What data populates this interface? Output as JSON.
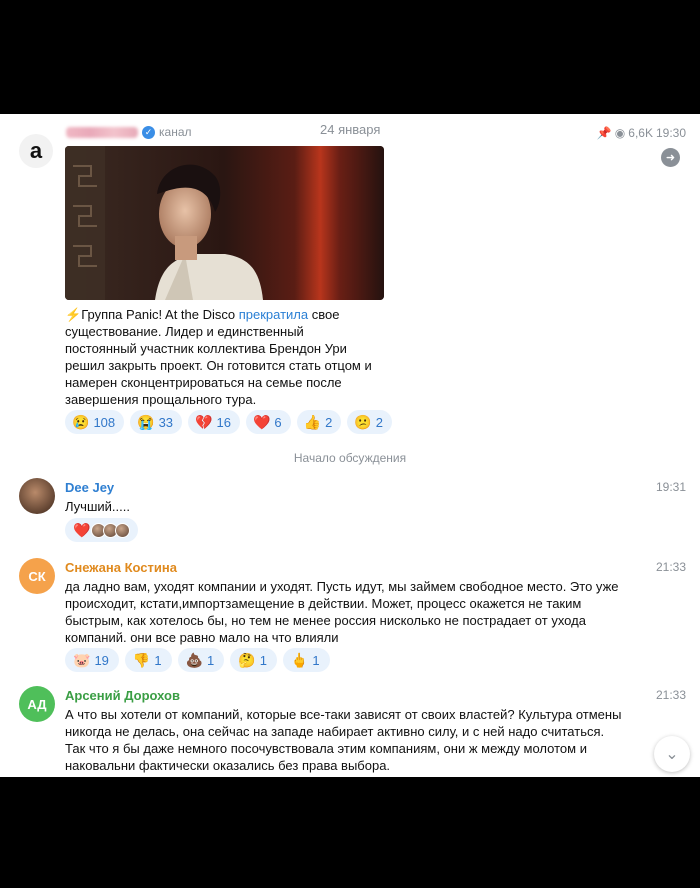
{
  "post": {
    "avatar_letter": "a",
    "channel_label": "канал",
    "date": "24 января",
    "views": "6,6K",
    "time": "19:30",
    "text_before": "Группа Panic! At the Disco ",
    "text_link": "прекратила",
    "text_after": " свое существование. Лидер и единственный постоянный участник коллектива Брендон Ури решил закрыть проект. Он готовится стать отцом и намерен сконцентрироваться на семье после завершения прощального тура.",
    "reactions": [
      {
        "emoji": "😢",
        "count": "108"
      },
      {
        "emoji": "😭",
        "count": "33"
      },
      {
        "emoji": "💔",
        "count": "16"
      },
      {
        "emoji": "❤️",
        "count": "6"
      },
      {
        "emoji": "👍",
        "count": "2"
      },
      {
        "emoji": "😕",
        "count": "2"
      }
    ]
  },
  "discussion_label": "Начало обсуждения",
  "comments": [
    {
      "name": "Dee Jey",
      "name_color": "#2f7fd1",
      "time": "19:31",
      "text": "Лучший.....",
      "reaction_emoji": "❤️"
    },
    {
      "initials": "СК",
      "avatar_color": "#f5a24b",
      "name": "Снежана Костина",
      "name_color": "#e08a1e",
      "time": "21:33",
      "text": "да ладно вам, уходят компании и уходят. Пусть идут, мы займем свободное место. Это уже происходит, кстати,импортзамещение в действии. Может, процесс окажется не таким быстрым, как хотелось бы, но тем не менее россия нисколько не пострадает от ухода компаний. они все равно мало на что влияли",
      "reactions": [
        {
          "emoji": "🐷",
          "count": "19"
        },
        {
          "emoji": "👎",
          "count": "1"
        },
        {
          "emoji": "💩",
          "count": "1"
        },
        {
          "emoji": "🤔",
          "count": "1"
        },
        {
          "emoji": "🖕",
          "count": "1"
        }
      ]
    },
    {
      "initials": "АД",
      "avatar_color": "#4fbf5a",
      "name": "Арсений Дорохов",
      "name_color": "#3a9e44",
      "time": "21:33",
      "text": "А что вы хотели от компаний, которые все-таки зависят от своих властей? Культура отмены никогда не делась, она сейчас на западе набирает активно силу, и с ней надо считаться. Так что я бы даже немного посочувствовала этим компаниям, они ж между молотом и наковальни фактически оказались без права выбора."
    }
  ],
  "icons": {
    "verified": "checkmark-badge-icon",
    "pin": "pin-icon",
    "views": "eye-icon",
    "share": "share-arrow-icon",
    "scroll": "chevron-down-icon"
  }
}
